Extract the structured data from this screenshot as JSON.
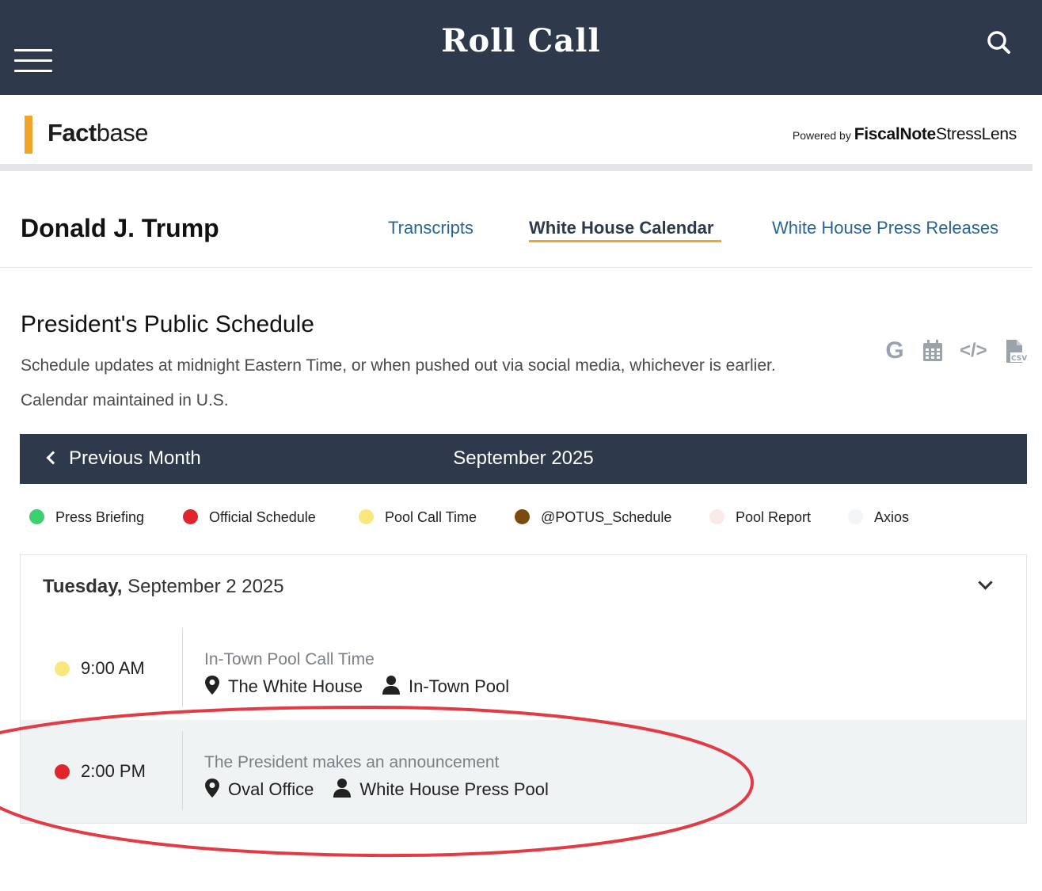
{
  "header": {
    "title": "Roll Call",
    "menu_icon": "hamburger-menu-icon",
    "search_icon": "search-icon",
    "background": "#2e3a4b"
  },
  "factbase": {
    "logo_bold": "Fact",
    "logo_light": "base",
    "accent_color": "#f0a52a",
    "powered_by_label": "Powered by",
    "fiscalnote": "FiscalNote",
    "stresslens": "StressLens"
  },
  "nav": {
    "person": "Donald J. Trump",
    "tabs": [
      {
        "label": "Transcripts",
        "active": false
      },
      {
        "label": "White House Calendar",
        "active": true
      },
      {
        "label": "White House Press Releases",
        "active": false
      }
    ]
  },
  "schedule": {
    "title": "President's Public Schedule",
    "description": "Schedule updates at midnight Eastern Time, or when pushed out via social media, whichever is earlier. Calendar maintained in U.S.",
    "tools": [
      {
        "icon": "google-icon",
        "glyph": "G"
      },
      {
        "icon": "calendar-icon"
      },
      {
        "icon": "embed-code-icon",
        "glyph": "</>"
      },
      {
        "icon": "csv-file-icon"
      }
    ]
  },
  "month_bar": {
    "previous_label": "Previous Month",
    "current_month": "September 2025"
  },
  "legend": [
    {
      "label": "Press Briefing",
      "color": "#3ecf6e"
    },
    {
      "label": "Official Schedule",
      "color": "#e0262b"
    },
    {
      "label": "Pool Call Time",
      "color": "#fbe77e"
    },
    {
      "label": "@POTUS_Schedule",
      "color": "#7a4a12"
    },
    {
      "label": "Pool Report",
      "color": "#fbeaea"
    },
    {
      "label": "Axios",
      "color": "#f4f5f7"
    }
  ],
  "day": {
    "weekday": "Tuesday,",
    "date": "September 2 2025",
    "events": [
      {
        "time": "9:00 AM",
        "dot_color": "#fbe77e",
        "title": "In-Town Pool Call Time",
        "location": "The White House",
        "attendee": "In-Town Pool"
      },
      {
        "time": "2:00 PM",
        "dot_color": "#e0262b",
        "title": "The President makes an announcement",
        "location": "Oval Office",
        "attendee": "White House Press Pool"
      }
    ]
  },
  "annotation": {
    "color": "#e23b45"
  }
}
